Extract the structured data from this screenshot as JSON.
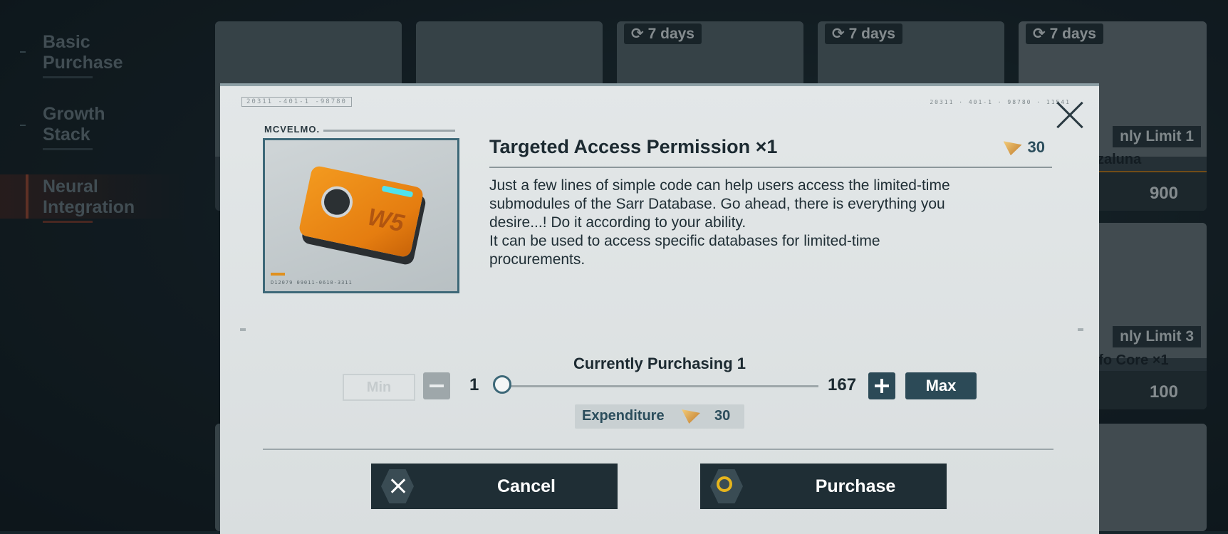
{
  "sidebar": {
    "items": [
      {
        "label": "Basic\nPurchase"
      },
      {
        "label": "Growth\nStack"
      },
      {
        "label": "Neural\nIntegration",
        "active": true
      }
    ]
  },
  "background_cards": {
    "badge_text": "7 days",
    "card1_limit": "nly Limit 1",
    "card1_name": "zzaluna",
    "card1_price": "900",
    "card2_limit": "nly Limit 3",
    "card2_name": "nfo Core ×1",
    "card2_price": "100"
  },
  "modal": {
    "brand": "MCVELMO.",
    "top_code_left": "20311  -401-1  -98780",
    "top_code_right": "20311 · 401-1 · 98780 · 11541",
    "item_code": "D12079 09011-0610-3311",
    "item_title": "Targeted Access Permission ×1",
    "item_price": "30",
    "description": "Just a few lines of simple code can help users access the limited-time\nsubmodules of the Sarr Database. Go ahead, there is everything you\ndesire...! Do it according to your ability.\nIt can be used to access specific databases for limited-time\nprocurements.",
    "quantity_label": "Currently Purchasing 1",
    "min_label": "Min",
    "qty_min": "1",
    "qty_max": "167",
    "max_label": "Max",
    "expenditure_label": "Expenditure",
    "expenditure_value": "30",
    "cancel_label": "Cancel",
    "purchase_label": "Purchase",
    "selected_quantity_fraction": 0
  },
  "colors": {
    "accent": "#2c4a57",
    "confirm_ring": "#e7b51c",
    "orange": "#c77c1a"
  },
  "icons": [
    "refresh-icon",
    "close-icon",
    "currency-icon",
    "minus-icon",
    "plus-icon",
    "cancel-x-icon",
    "purchase-circle-icon"
  ]
}
